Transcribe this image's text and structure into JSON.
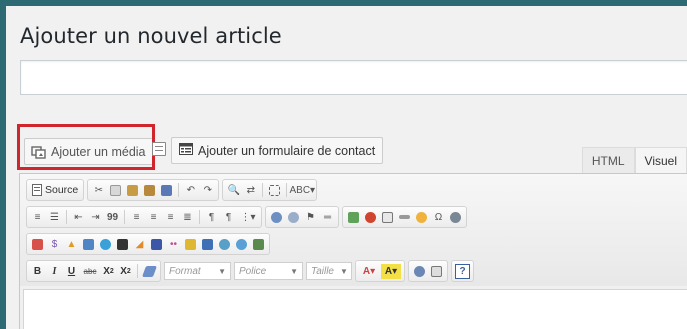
{
  "page": {
    "title": "Ajouter un nouvel article",
    "title_input_value": ""
  },
  "media_buttons": {
    "add_media_label": "Ajouter un média",
    "add_form_label": "Ajouter un formulaire de contact"
  },
  "editor_tabs": [
    "HTML",
    "Visuel"
  ],
  "toolbar": {
    "source_label": "Source",
    "format_placeholder": "Format",
    "font_placeholder": "Police",
    "size_placeholder": "Taille",
    "bold": "B",
    "italic": "I",
    "underline": "U",
    "strike": "abc",
    "subscript": "X",
    "superscript": "X",
    "help": "?",
    "quote": "99",
    "text_color": "A",
    "bg_color": "A"
  },
  "colors": {
    "outer_background": "#2e6a73",
    "highlight_box": "#d0252c"
  }
}
